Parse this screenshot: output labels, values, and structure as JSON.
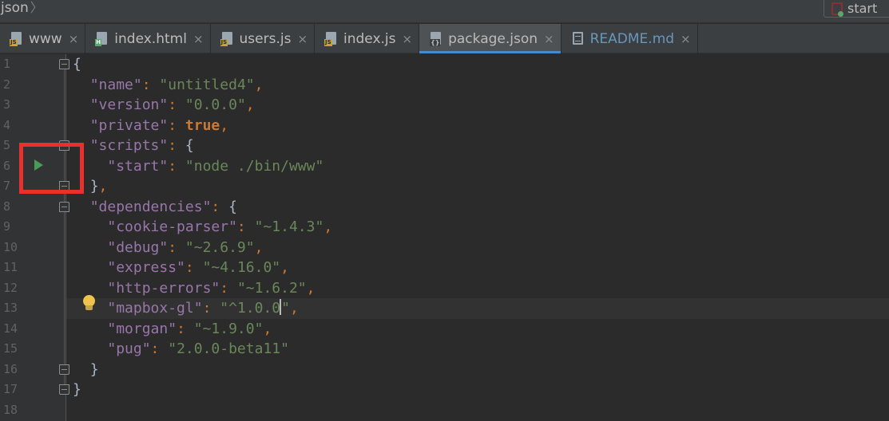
{
  "breadcrumb": {
    "text": "json"
  },
  "run_config": {
    "label": "start",
    "icon": "npm-run-config-icon"
  },
  "tabs": [
    {
      "label": "www",
      "icon": "js-file-icon",
      "type": "js",
      "active": false
    },
    {
      "label": "index.html",
      "icon": "html-file-icon",
      "type": "html",
      "active": false
    },
    {
      "label": "users.js",
      "icon": "js-file-icon",
      "type": "js",
      "active": false
    },
    {
      "label": "index.js",
      "icon": "js-file-icon",
      "type": "js",
      "active": false
    },
    {
      "label": "package.json",
      "icon": "json-file-icon",
      "type": "json",
      "active": true
    },
    {
      "label": "README.md",
      "icon": "markdown-file-icon",
      "type": "md",
      "active": false
    }
  ],
  "tab_close_glyph": "×",
  "editor": {
    "line_numbers": [
      "1",
      "2",
      "3",
      "4",
      "5",
      "6",
      "7",
      "8",
      "9",
      "10",
      "11",
      "12",
      "13",
      "14",
      "15",
      "16",
      "17",
      "18"
    ],
    "current_line": 13,
    "lines": [
      {
        "text": "{"
      },
      {
        "text": "  \"name\": \"untitled4\","
      },
      {
        "text": "  \"version\": \"0.0.0\","
      },
      {
        "text": "  \"private\": true,"
      },
      {
        "text": "  \"scripts\": {"
      },
      {
        "text": "    \"start\": \"node ./bin/www\""
      },
      {
        "text": "  },"
      },
      {
        "text": "  \"dependencies\": {"
      },
      {
        "text": "    \"cookie-parser\": \"~1.4.3\","
      },
      {
        "text": "    \"debug\": \"~2.6.9\","
      },
      {
        "text": "    \"express\": \"~4.16.0\","
      },
      {
        "text": "    \"http-errors\": \"~1.6.2\","
      },
      {
        "text": "    \"mapbox-gl\": \"^1.0.0\","
      },
      {
        "text": "    \"morgan\": \"~1.9.0\","
      },
      {
        "text": "    \"pug\": \"2.0.0-beta11\""
      },
      {
        "text": "  }"
      },
      {
        "text": "}"
      },
      {
        "text": ""
      }
    ]
  },
  "gutter_icons": {
    "run_script_icon": "run-triangle-icon",
    "intention_icon": "lightbulb-icon"
  },
  "colors": {
    "background": "#2b2b2b",
    "key": "#9876aa",
    "string": "#6a8759",
    "keyword": "#cc7832",
    "run_icon": "#499c54",
    "highlight_box": "#e8312c",
    "active_tab_underline": "#4a88c7"
  }
}
